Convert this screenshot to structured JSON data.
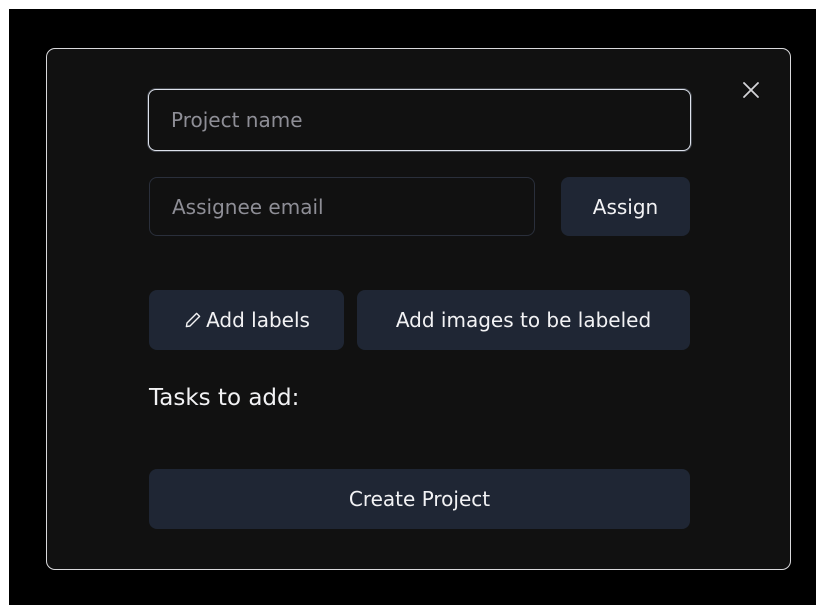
{
  "dialog": {
    "close_label": "×",
    "project_name": {
      "value": "",
      "placeholder": "Project name"
    },
    "assignee_email": {
      "value": "",
      "placeholder": "Assignee email"
    },
    "assign_label": "Assign",
    "add_labels_label": "Add labels",
    "add_images_label": "Add images to be labeled",
    "tasks_heading": "Tasks to add:",
    "create_label": "Create Project"
  },
  "icons": {
    "close": "close-icon",
    "pencil": "pencil-icon"
  },
  "colors": {
    "page_background": "#000000",
    "dialog_background": "#111111",
    "dialog_border": "#d9d9dc",
    "button_background": "#1f2634",
    "text": "#f2f2f4",
    "placeholder": "#8e8e96",
    "focused_input_border": "#dde2ec"
  }
}
